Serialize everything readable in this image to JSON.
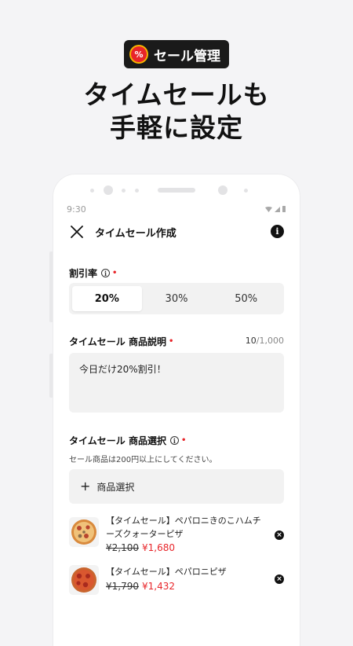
{
  "badge": {
    "text": "セール管理",
    "icon": "%"
  },
  "headline": {
    "line1": "タイムセールも",
    "line2": "手軽に設定"
  },
  "status_bar": {
    "time": "9:30"
  },
  "screen": {
    "title": "タイムセール作成",
    "info_icon": "i"
  },
  "discount": {
    "label": "割引率",
    "required_mark": "•",
    "options": [
      "20%",
      "30%",
      "50%"
    ],
    "selected": "20%"
  },
  "description": {
    "label": "タイムセール 商品説明",
    "required_mark": "•",
    "counter_current": "10",
    "counter_max": "/1,000",
    "value": "今日だけ20%割引！"
  },
  "product_select": {
    "label": "タイムセール 商品選択",
    "required_mark": "•",
    "hint": "セール商品は200円以上にしてください。",
    "button_label": "商品選択"
  },
  "products": [
    {
      "name": "【タイムセール】ペパロニきのこハムチーズクォーターピザ",
      "old_price": "¥2,100",
      "new_price": "¥1,680"
    },
    {
      "name": "【タイムセール】ペパロニピザ",
      "old_price": "¥1,790",
      "new_price": "¥1,432"
    }
  ],
  "colors": {
    "accent": "#e8252a",
    "badge_bg": "#1a1a1a",
    "background": "#f4f4f6"
  },
  "icons": [
    "percent-seal-icon",
    "close-icon",
    "info-icon",
    "plus-icon",
    "remove-icon",
    "wifi-icon",
    "signal-icon",
    "battery-icon"
  ]
}
